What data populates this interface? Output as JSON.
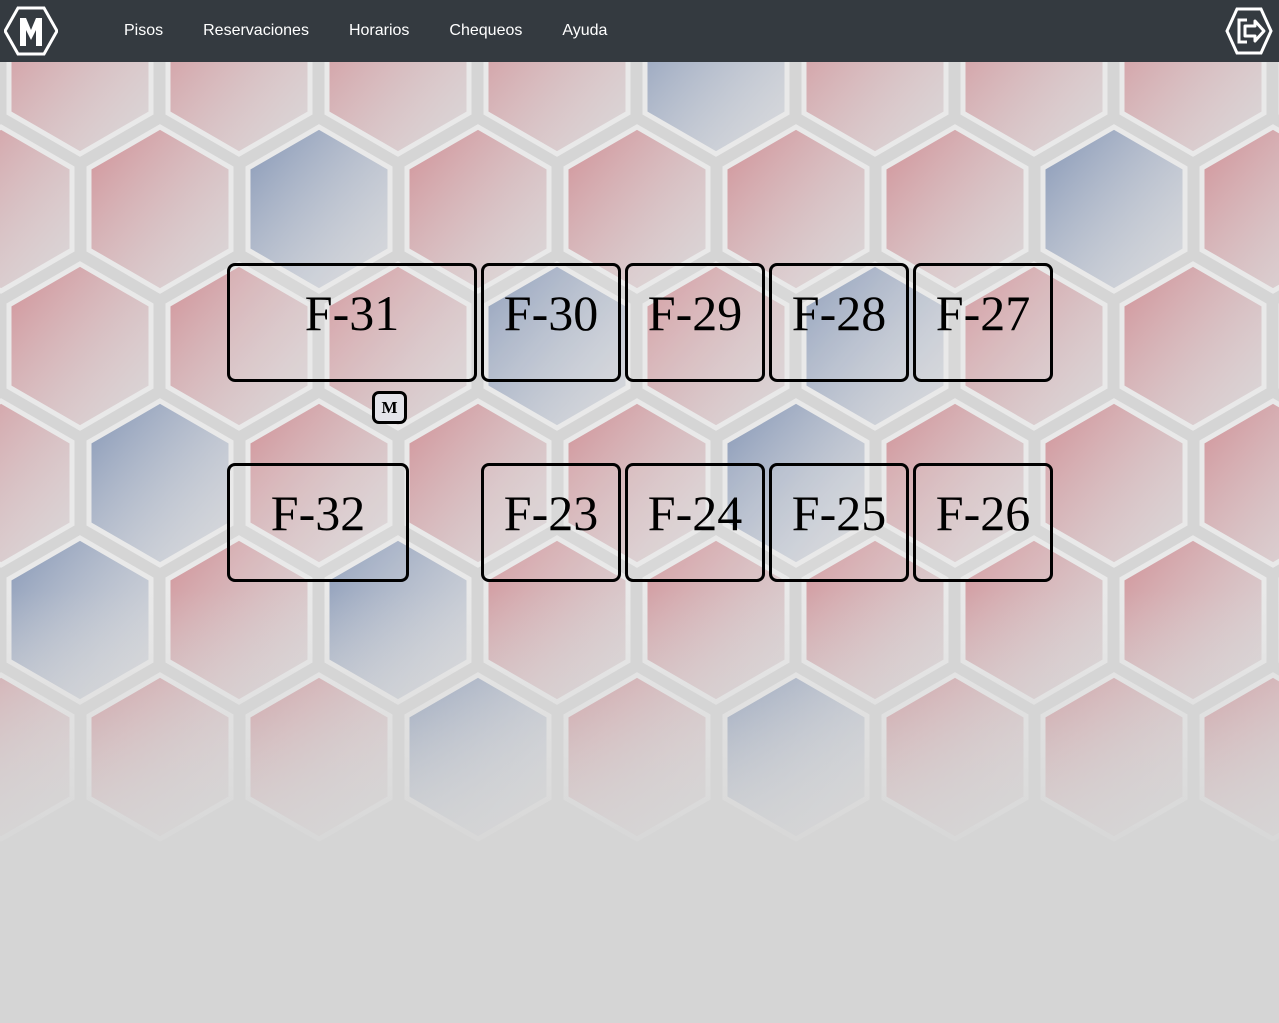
{
  "nav": {
    "items": [
      {
        "label": "Pisos"
      },
      {
        "label": "Reservaciones"
      },
      {
        "label": "Horarios"
      },
      {
        "label": "Chequeos"
      },
      {
        "label": "Ayuda"
      }
    ],
    "logo_icon": "brand-m-hexagon-logo",
    "logout_icon": "exit-hexagon-arrow-icon"
  },
  "rooms": {
    "f31": "F-31",
    "f30": "F-30",
    "f29": "F-29",
    "f28": "F-28",
    "f27": "F-27",
    "f32": "F-32",
    "f23": "F-23",
    "f24": "F-24",
    "f25": "F-25",
    "f26": "F-26"
  },
  "marker": {
    "label": "M"
  },
  "colors": {
    "navbar": "#343a40",
    "background": "#d5d5d5",
    "hex_red": "#d9868c",
    "hex_blue": "#7489b0",
    "room_border": "#000000"
  }
}
